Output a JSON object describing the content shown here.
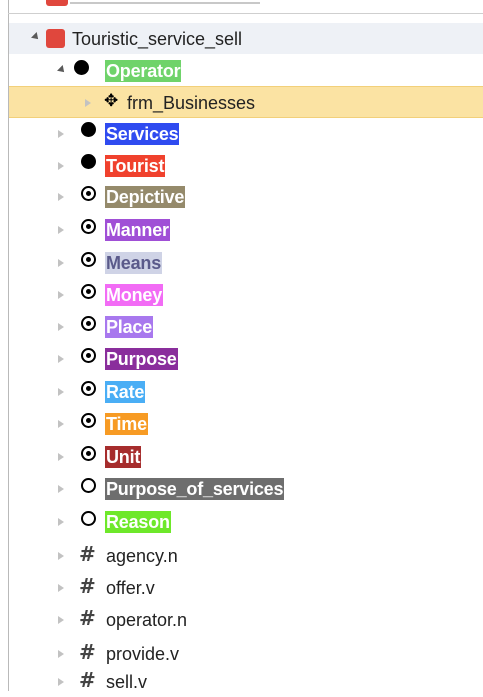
{
  "tree": {
    "root": {
      "label": "Touristic_service_sell"
    },
    "operator": {
      "label": "Operator",
      "color": "#6fd36a",
      "child": {
        "label": "frm_Businesses"
      }
    },
    "core_frames": [
      {
        "label": "Services",
        "color": "#2f4bf0"
      },
      {
        "label": "Tourist",
        "color": "#f0412d"
      }
    ],
    "peripheral_frames": [
      {
        "label": "Depictive",
        "color": "#958a6b"
      },
      {
        "label": "Manner",
        "color": "#a04fd6"
      },
      {
        "label": "Means",
        "color": "#cfd3e6",
        "text_color": "#5a5a8a"
      },
      {
        "label": "Money",
        "color": "#f26cf5"
      },
      {
        "label": "Place",
        "color": "#a878ee"
      },
      {
        "label": "Purpose",
        "color": "#8a2e9c"
      },
      {
        "label": "Rate",
        "color": "#4aaef5"
      },
      {
        "label": "Time",
        "color": "#f79b24"
      },
      {
        "label": "Unit",
        "color": "#a62d2d"
      }
    ],
    "extra_frames": [
      {
        "label": "Purpose_of_services",
        "color": "#6e6e6e"
      },
      {
        "label": "Reason",
        "color": "#6ee82a"
      }
    ],
    "lexical_units": [
      {
        "label": "agency.n"
      },
      {
        "label": "offer.v"
      },
      {
        "label": "operator.n"
      },
      {
        "label": "provide.v"
      },
      {
        "label": "sell.v"
      }
    ]
  }
}
